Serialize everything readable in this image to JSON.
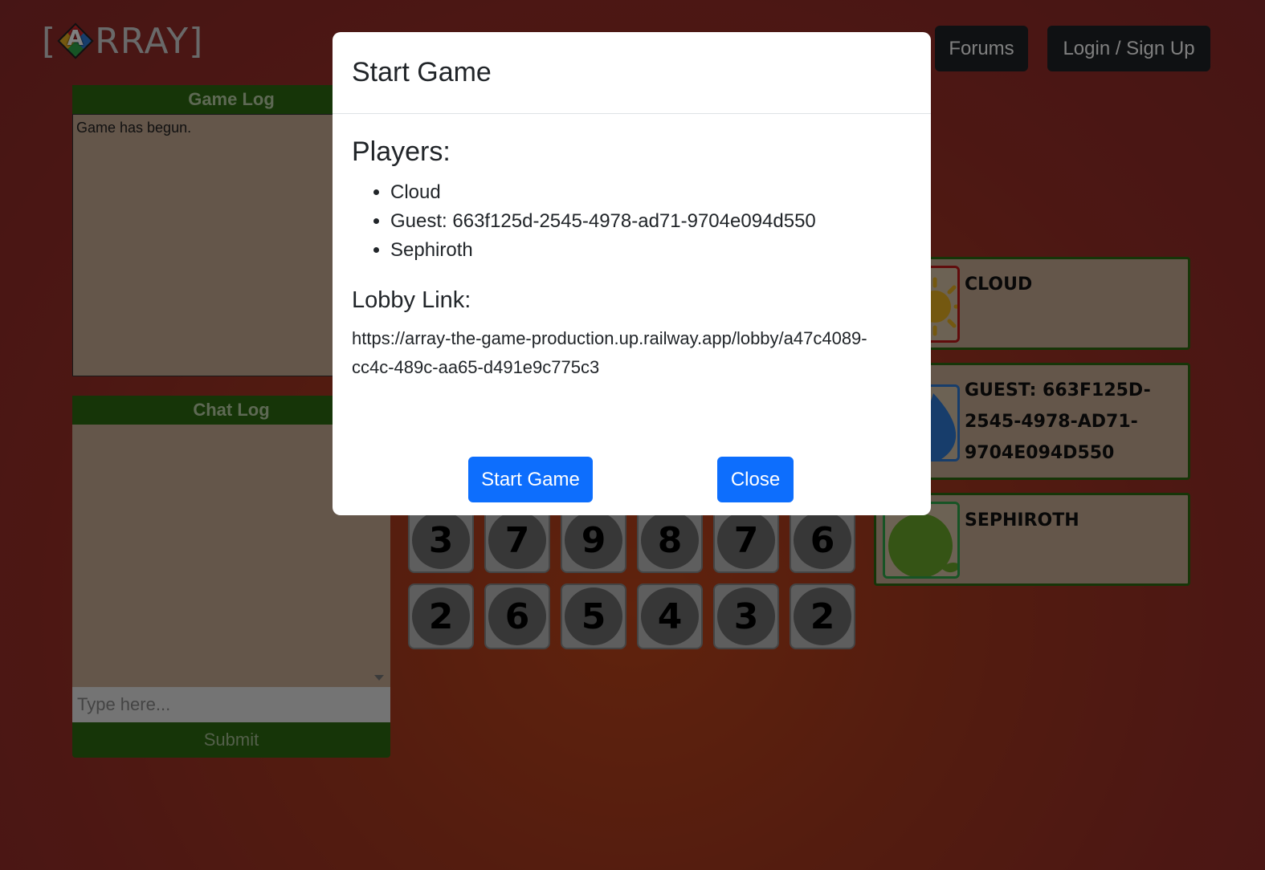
{
  "app": {
    "logo_left_bracket": "[",
    "logo_letter": "A",
    "logo_rest": "RRAY]"
  },
  "nav": {
    "forums_label": "Forums",
    "login_label": "Login / Sign Up"
  },
  "game_log": {
    "title": "Game Log",
    "entries": [
      "Game has begun."
    ]
  },
  "chat_log": {
    "title": "Chat Log",
    "input_placeholder": "Type here...",
    "submit_label": "Submit"
  },
  "number_grid": {
    "rows": [
      [
        "3",
        "7",
        "9",
        "8",
        "7",
        "6"
      ],
      [
        "2",
        "6",
        "5",
        "4",
        "3",
        "2"
      ]
    ]
  },
  "player_cards": [
    {
      "name": "Cloud",
      "avatar_color": "#e8b020",
      "border_color": "#c01818"
    },
    {
      "name": "Guest: 663f125d-2545-4978-ad71-9704e094d550",
      "avatar_color": "#2e7bd6",
      "border_color": "#2e7bd6"
    },
    {
      "name": "Sephiroth",
      "avatar_color": "#6aa82a",
      "border_color": "#2fa84a"
    }
  ],
  "modal": {
    "title": "Start Game",
    "players_heading": "Players:",
    "players": [
      "Cloud",
      "Guest: 663f125d-2545-4978-ad71-9704e094d550",
      "Sephiroth"
    ],
    "lobby_heading": "Lobby Link:",
    "lobby_link": "https://array-the-game-production.up.railway.app/lobby/a47c4089-cc4c-489c-aa65-d491e9c775c3",
    "start_button": "Start Game",
    "close_button": "Close"
  },
  "colors": {
    "primary": "#0d6efd",
    "panel_green": "#2d6a10",
    "background_red": "#a8391f"
  }
}
